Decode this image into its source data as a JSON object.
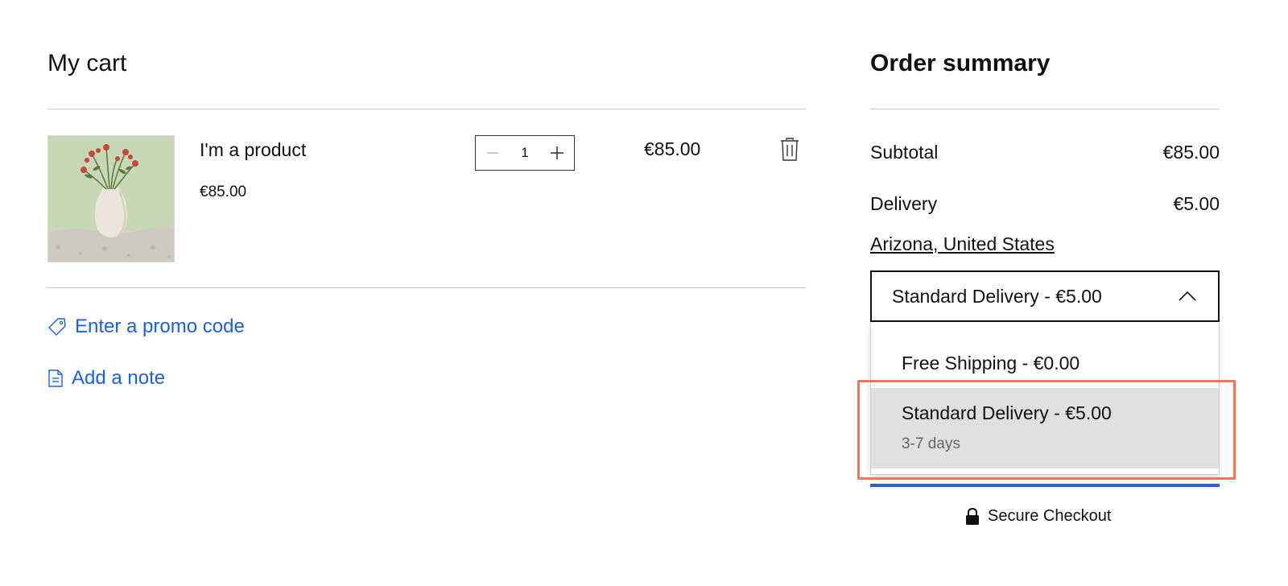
{
  "cart": {
    "title": "My cart",
    "item": {
      "name": "I'm a product",
      "unit_price": "€85.00",
      "quantity": "1",
      "line_total": "€85.00",
      "image_icon": "vase-with-flowers-image"
    },
    "promo_label": "Enter a promo code",
    "note_label": "Add a note"
  },
  "summary": {
    "title": "Order summary",
    "subtotal_label": "Subtotal",
    "subtotal_value": "€85.00",
    "delivery_label": "Delivery",
    "delivery_value": "€5.00",
    "location": "Arizona, United States",
    "delivery_select": {
      "selected": "Standard Delivery - €5.00",
      "options": [
        {
          "label": "Free Shipping - €0.00",
          "detail": ""
        },
        {
          "label": "Standard Delivery - €5.00",
          "detail": "3-7 days"
        }
      ]
    },
    "secure_label": "Secure Checkout"
  },
  "colors": {
    "link": "#1c60e0",
    "highlight": "#f27459",
    "checkout_accent": "#2f5ed4",
    "option_hover": "#e0e0e0"
  }
}
